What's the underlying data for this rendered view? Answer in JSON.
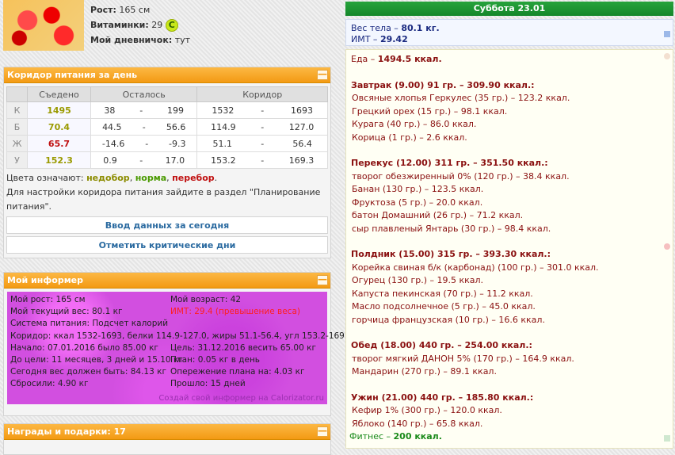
{
  "profile": {
    "height_label": "Рост:",
    "height_value": "165 см",
    "vitamins_label": "Витаминки:",
    "vitamins_value": "29",
    "vitamins_badge": "C",
    "diary_label": "Мой дневничок:",
    "diary_value": "тут"
  },
  "corridor": {
    "title": "Коридор питания за день",
    "collapse": "—",
    "headers": [
      "",
      "Съедено",
      "Осталось",
      "Коридор"
    ],
    "rows": [
      {
        "label": "К",
        "eaten": "1495",
        "eaten_color": "olive",
        "left_a": "38",
        "left_b": "199",
        "corr_a": "1532",
        "corr_b": "1693"
      },
      {
        "label": "Б",
        "eaten": "70.4",
        "eaten_color": "olive",
        "left_a": "44.5",
        "left_b": "56.6",
        "corr_a": "114.9",
        "corr_b": "127.0"
      },
      {
        "label": "Ж",
        "eaten": "65.7",
        "eaten_color": "red",
        "left_a": "-14.6",
        "left_b": "-9.3",
        "corr_a": "51.1",
        "corr_b": "56.4"
      },
      {
        "label": "У",
        "eaten": "152.3",
        "eaten_color": "olive",
        "left_a": "0.9",
        "left_b": "17.0",
        "corr_a": "153.2",
        "corr_b": "169.3"
      }
    ],
    "dash": "-",
    "legend_prefix": "Цвета означают:",
    "legend_under": "недобор",
    "legend_norm": "норма",
    "legend_over": "перебор",
    "hint": "Для настройки коридора питания зайдите в раздел \"Планирование питания\".",
    "btn_input": "Ввод данных за сегодня",
    "btn_critical": "Отметить критические дни"
  },
  "informer": {
    "title": "Мой информер",
    "collapse": "—",
    "left": [
      "Мой рост: 165 см",
      "Мой текущий вес: 80.1 кг",
      "Система питания: Подсчет калорий",
      "Коридор: ккал 1532-1693, белки 114.9-127.0, жиры 51.1-56.4, угл 153.2-169.3",
      "Начало: 07.01.2016 было 85.00 кг",
      "До цели: 11 месяцев, 3 дней и 15.10 кг",
      "Сегодня вес должен быть: 84.13 кг",
      "Сбросили: 4.90 кг"
    ],
    "right": [
      "Мой возраст: 42",
      "ИМТ: 29.4 (превышение веса)",
      "",
      "",
      "Цель: 31.12.2016 весить 65.00 кг",
      "План: 0.05 кг в день",
      "Опережение плана на: 4.03 кг",
      "Прошло: 15 дней"
    ],
    "footer": "Создай свой информер на Calorizator.ru"
  },
  "awards": {
    "title": "Награды и подарки: 17",
    "collapse": "—"
  },
  "day": {
    "title": "Суббота 23.01",
    "weight_label": "Вес тела –",
    "weight_value": "80.1 кг.",
    "bmi_label": "ИМТ –",
    "bmi_value": "29.42",
    "food_label": "Еда –",
    "food_value": "1494.5 ккал.",
    "meals": [
      {
        "head": "Завтрак (9.00) 91 гр. – 309.90 ккал.:",
        "items": [
          "Овсяные хлопья Геркулес (35 гр.) – 123.2 ккал.",
          "Грецкий орех (15 гр.) – 98.1 ккал.",
          "Курага (40 гр.) – 86.0 ккал.",
          "Корица (1 гр.) – 2.6 ккал."
        ]
      },
      {
        "head": "Перекус (12.00) 311 гр. – 351.50 ккал.:",
        "items": [
          "творог обезжиренный 0% (120 гр.) – 38.4 ккал.",
          "Банан (130 гр.) – 123.5 ккал.",
          "Фруктоза (5 гр.) – 20.0 ккал.",
          "батон Домашний (26 гр.) – 71.2 ккал.",
          "сыр плавленый Янтарь (30 гр.) – 98.4 ккал."
        ]
      },
      {
        "head": "Полдник (15.00) 315 гр. – 393.30 ккал.:",
        "items": [
          "Корейка свиная б/к (карбонад) (100 гр.) – 301.0 ккал.",
          "Огурец (130 гр.) – 19.5 ккал.",
          "Капуста пекинская (70 гр.) – 11.2 ккал.",
          "Масло подсолнечное (5 гр.) – 45.0 ккал.",
          "горчица французская (10 гр.) – 16.6 ккал."
        ]
      },
      {
        "head": "Обед (18.00) 440 гр. – 254.00 ккал.:",
        "items": [
          "творог мягкий ДАНОН 5% (170 гр.) – 164.9 ккал.",
          "Мандарин (270 гр.) – 89.1 ккал."
        ]
      },
      {
        "head": "Ужин (21.00) 440 гр. – 185.80 ккал.:",
        "items": [
          "Кефир 1% (300 гр.) – 120.0 ккал.",
          "Яблоко (140 гр.) – 65.8 ккал."
        ]
      }
    ],
    "fitness_label": "Фитнес –",
    "fitness_value": "200 ккал."
  }
}
